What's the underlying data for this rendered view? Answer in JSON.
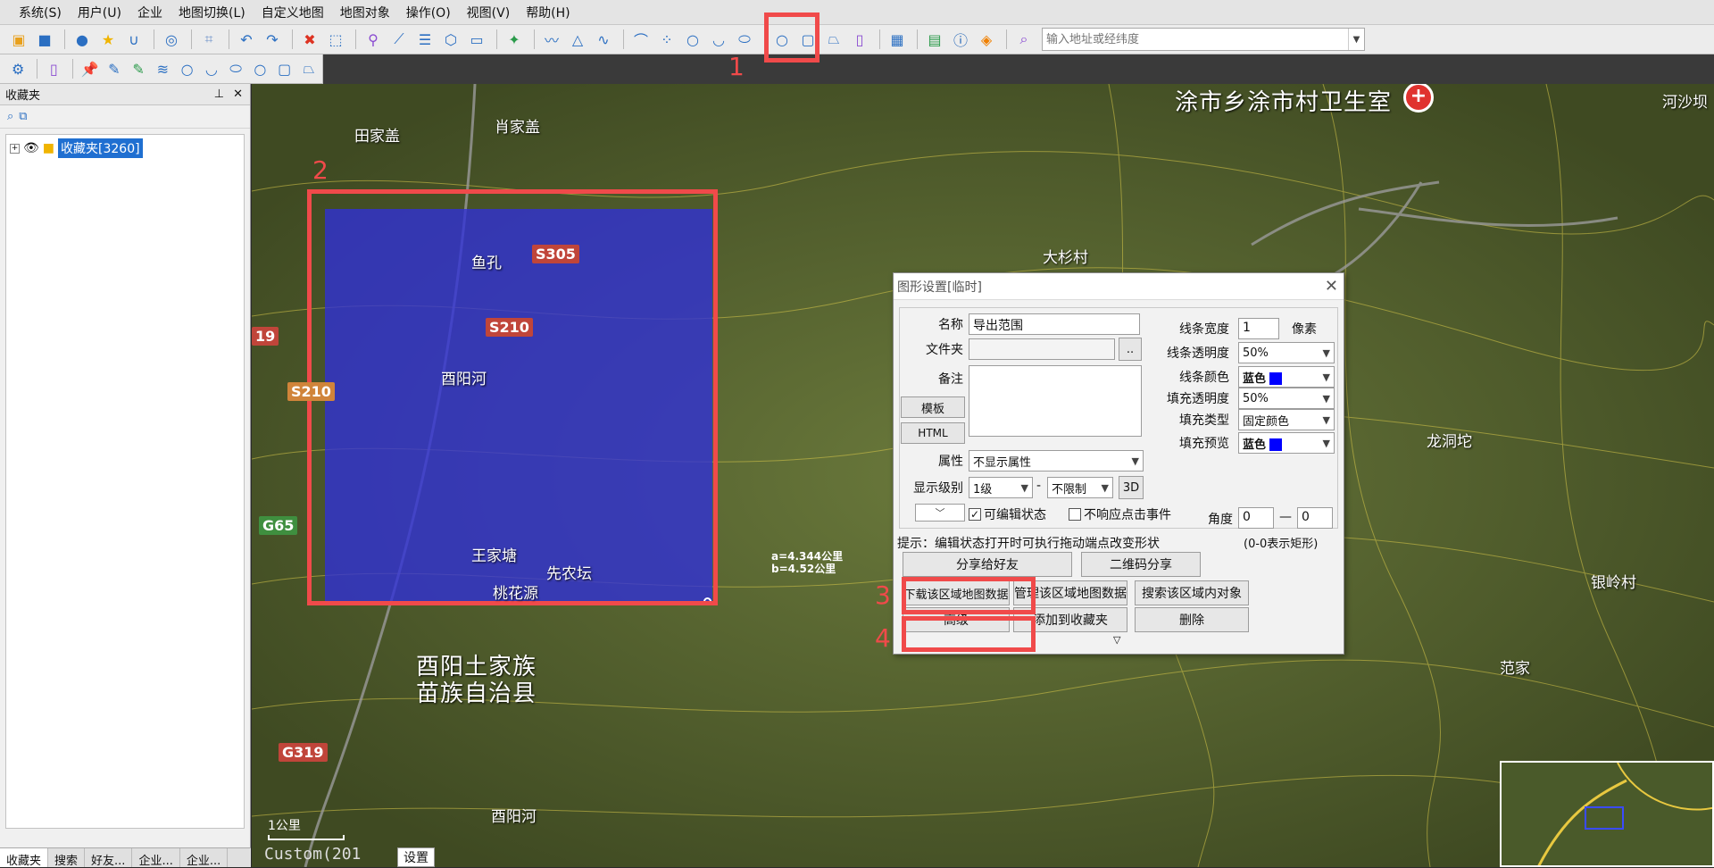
{
  "menu": [
    "系统(S)",
    "用户(U)",
    "企业",
    "地图切换(L)",
    "自定义地图",
    "地图对象",
    "操作(O)",
    "视图(V)",
    "帮助(H)"
  ],
  "search": {
    "placeholder": "输入地址或经纬度"
  },
  "sidebar": {
    "title": "收藏夹",
    "tree_root": "收藏夹[3260]",
    "bottom_tabs": [
      "收藏夹",
      "搜索",
      "好友...",
      "企业...",
      "企业..."
    ]
  },
  "annotations": [
    "1",
    "2",
    "3",
    "4"
  ],
  "map": {
    "places": {
      "clinic": "涂市乡涂市村卫生室",
      "tianjiagai": "田家盖",
      "xiaojiagai": "肖家盖",
      "hetou": "河沙坝",
      "dashancun": "大杉村",
      "yukong": "鱼孔",
      "youyanghe": "酉阳河",
      "wangjiatang": "王家塘",
      "xiannongtan": "先农坛",
      "taohuayuan": "桃花源",
      "county": "酉阳土家族",
      "county2": "苗族自治县",
      "longdongtuo": "龙洞坨",
      "yinlingcun": "银岭村",
      "fanjia": "范家",
      "youyanghe_south": "酉阳河"
    },
    "roads": [
      "S305",
      "S210",
      "S210",
      "19",
      "G65",
      "G319"
    ],
    "area_text": [
      "a=4.344公里",
      "b=4.52公里"
    ],
    "scale": "1公里",
    "custom": "Custom(201",
    "settings": "设置"
  },
  "dialog": {
    "title": "图形设置[临时]",
    "name_label": "名称",
    "name_value": "导出范围",
    "folder_label": "文件夹",
    "folder_btn": "..",
    "note_label": "备注",
    "template_btn": "模板",
    "html_btn": "HTML",
    "attr_label": "属性",
    "attr_value": "不显示属性",
    "level_label": "显示级别",
    "level_from": "1级",
    "level_dash": "-",
    "level_to": "不限制",
    "btn_3d": "3D",
    "editable_label": "可编辑状态",
    "no_click_label": "不响应点击事件",
    "line_width_label": "线条宽度",
    "line_width_value": "1",
    "line_width_unit": "像素",
    "line_opacity_label": "线条透明度",
    "line_opacity_value": "50%",
    "line_color_label": "线条颜色",
    "line_color_value": "蓝色",
    "fill_opacity_label": "填充透明度",
    "fill_opacity_value": "50%",
    "fill_type_label": "填充类型",
    "fill_type_value": "固定颜色",
    "fill_preview_label": "填充预览",
    "fill_preview_value": "蓝色",
    "angle_label": "角度",
    "angle_a": "0",
    "angle_dash": "—",
    "angle_b": "0",
    "hint": "提示：编辑状态打开时可执行拖动端点改变形状",
    "hint2": "(0-0表示矩形)",
    "share_friend": "分享给好友",
    "qr_share": "二维码分享",
    "download": "下载该区域地图数据",
    "manage": "管理该区域地图数据",
    "search_objects": "搜索该区域内对象",
    "advanced": "高级",
    "add_fav": "添加到收藏夹",
    "delete": "删除",
    "more": "▽"
  },
  "colors": {
    "accent_red": "#f04a4a",
    "fill_blue": "#2f2fd8",
    "swatch": "#0000ff"
  }
}
